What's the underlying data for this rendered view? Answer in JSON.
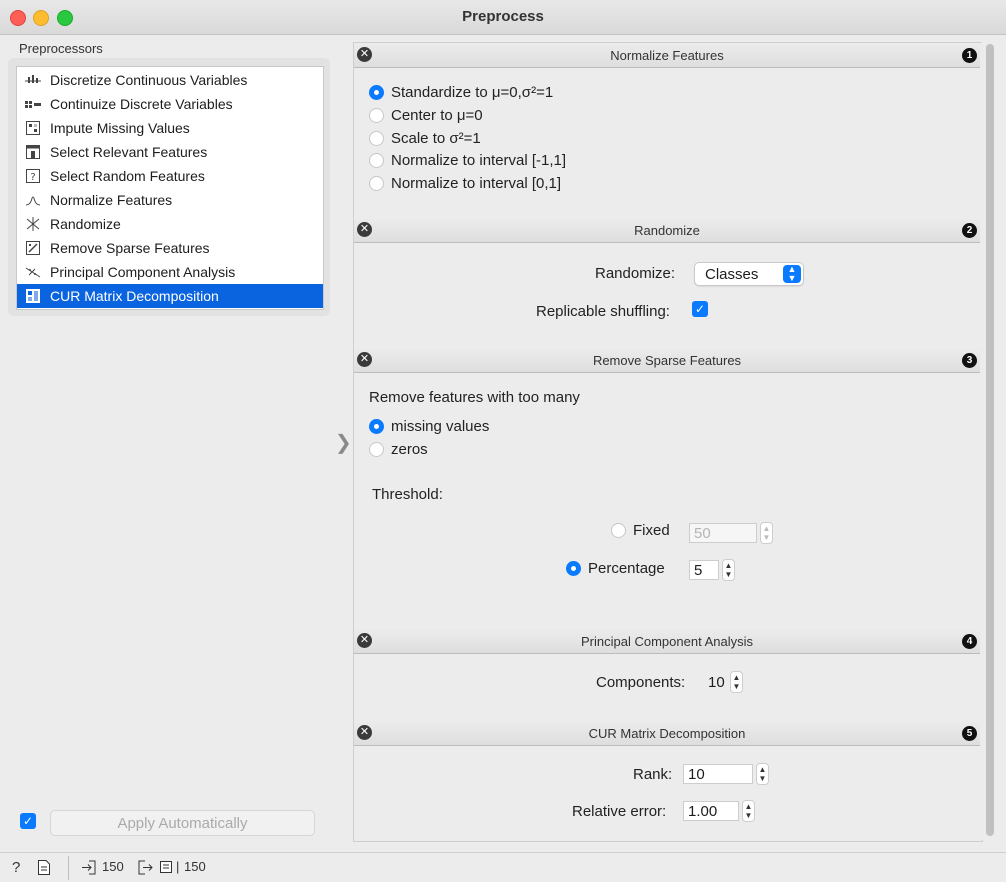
{
  "window": {
    "title": "Preprocess"
  },
  "left": {
    "label": "Preprocessors",
    "items": [
      {
        "label": "Discretize Continuous Variables",
        "icon": "discretize-icon"
      },
      {
        "label": "Continuize Discrete Variables",
        "icon": "continuize-icon"
      },
      {
        "label": "Impute Missing Values",
        "icon": "impute-icon"
      },
      {
        "label": "Select Relevant Features",
        "icon": "select-relevant-icon"
      },
      {
        "label": "Select Random Features",
        "icon": "select-random-icon"
      },
      {
        "label": "Normalize Features",
        "icon": "normalize-icon"
      },
      {
        "label": "Randomize",
        "icon": "randomize-icon"
      },
      {
        "label": "Remove Sparse Features",
        "icon": "remove-sparse-icon"
      },
      {
        "label": "Principal Component Analysis",
        "icon": "pca-icon"
      },
      {
        "label": "CUR Matrix Decomposition",
        "icon": "cur-icon",
        "selected": true
      }
    ],
    "apply_label": "Apply Automatically",
    "apply_checked": true
  },
  "sections": {
    "normalize": {
      "title": "Normalize Features",
      "num": "1",
      "options": [
        "Standardize to μ=0,σ²=1",
        "Center to μ=0",
        "Scale to σ²=1",
        "Normalize to interval [-1,1]",
        "Normalize to interval [0,1]"
      ],
      "selected_index": 0
    },
    "randomize": {
      "title": "Randomize",
      "num": "2",
      "randomize_label": "Randomize:",
      "randomize_value": "Classes",
      "replicable_label": "Replicable shuffling:",
      "replicable_checked": true
    },
    "sparse": {
      "title": "Remove Sparse Features",
      "num": "3",
      "intro": "Remove features with too many",
      "options": [
        "missing values",
        "zeros"
      ],
      "selected_index": 0,
      "threshold_label": "Threshold:",
      "fixed_label": "Fixed",
      "fixed_value": "50",
      "percentage_label": "Percentage",
      "percentage_value": "5"
    },
    "pca": {
      "title": "Principal Component Analysis",
      "num": "4",
      "components_label": "Components:",
      "components_value": "10"
    },
    "cur": {
      "title": "CUR Matrix Decomposition",
      "num": "5",
      "rank_label": "Rank:",
      "rank_value": "10",
      "error_label": "Relative error:",
      "error_value": "1.00"
    }
  },
  "status": {
    "input_count": "150",
    "output_count": "150",
    "separator": "|"
  }
}
